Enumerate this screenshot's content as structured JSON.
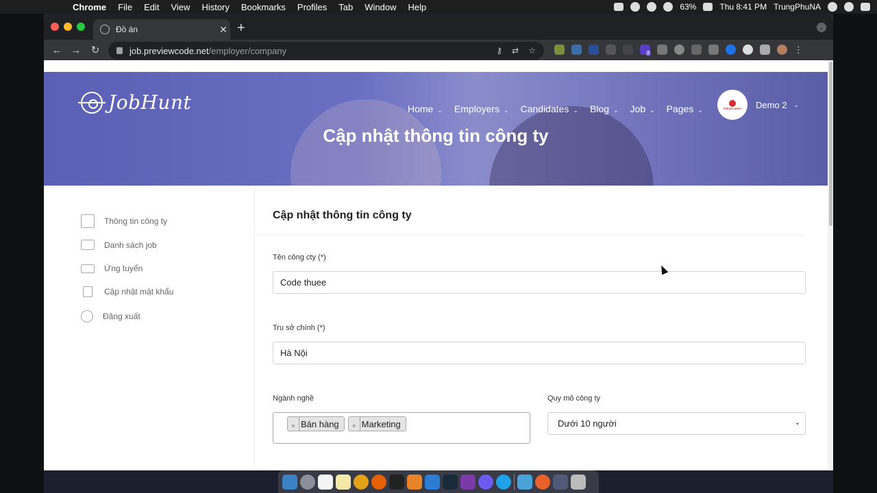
{
  "menubar": {
    "app_name": "Chrome",
    "menus": [
      "File",
      "Edit",
      "View",
      "History",
      "Bookmarks",
      "Profiles",
      "Tab",
      "Window",
      "Help"
    ],
    "battery": "63%",
    "clock": "Thu 8:41 PM",
    "user": "TrungPhuNA"
  },
  "browser": {
    "tab_title": "Đồ án",
    "url_host": "job.previewcode.net",
    "url_path": "/employer/company",
    "extension_badge": "8"
  },
  "site": {
    "logo": "JobHunt",
    "nav": [
      {
        "label": "Home"
      },
      {
        "label": "Employers"
      },
      {
        "label": "Candidates"
      },
      {
        "label": "Blog"
      },
      {
        "label": "Job"
      },
      {
        "label": "Pages"
      }
    ],
    "user_name": "Demo 2",
    "avatar_brand": "TERAPLANET",
    "hero_title": "Cập nhật thông tin công ty"
  },
  "sidebar": {
    "items": [
      {
        "label": "Thông tin công ty",
        "icon": "document-icon"
      },
      {
        "label": "Danh sách job",
        "icon": "briefcase-icon"
      },
      {
        "label": "Ứng tuyển",
        "icon": "cash-icon"
      },
      {
        "label": "Cập nhật mật khẩu",
        "icon": "lock-icon"
      },
      {
        "label": "Đăng xuất",
        "icon": "link-icon"
      }
    ]
  },
  "form": {
    "heading": "Cập nhật thông tin công ty",
    "company_name_label": "Tên công cty (*)",
    "company_name_value": "Code thuee",
    "headquarters_label": "Trụ sở chính (*)",
    "headquarters_value": "Hà Nội",
    "industry_label": "Ngành nghề",
    "industry_tags": [
      "Bán hàng",
      "Marketing"
    ],
    "size_label": "Quy mô công ty",
    "size_value": "Dưới 10 người"
  }
}
